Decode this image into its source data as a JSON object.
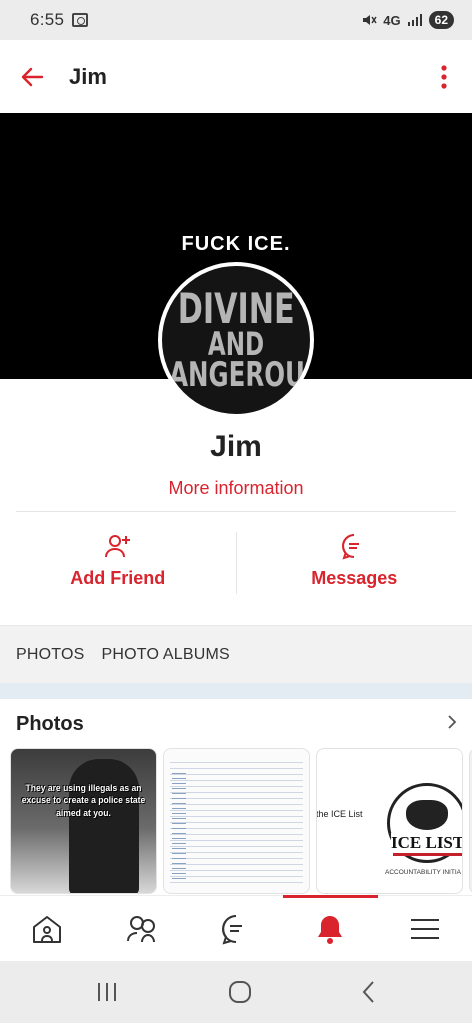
{
  "status_bar": {
    "time": "6:55",
    "network": "4G",
    "battery": "62"
  },
  "header": {
    "title": "Jim"
  },
  "cover": {
    "text": "FUCK ICE."
  },
  "avatar": {
    "line1": "DIVINE",
    "line2": "AND",
    "line3": "DANGEROUS"
  },
  "profile": {
    "name": "Jim",
    "more_info": "More information"
  },
  "actions": {
    "add_friend": "Add Friend",
    "messages": "Messages"
  },
  "tabs": [
    "PHOTOS",
    "PHOTO ALBUMS"
  ],
  "photos": {
    "title": "Photos",
    "thumb1_caption": "They are using illegals as an excuse to create a police state aimed at you.",
    "thumb3_text": "the ICE List",
    "thumb3_label": "ICE LIST",
    "thumb3_footer": "ACCOUNTABILITY INITIA"
  },
  "colors": {
    "accent": "#d9232d",
    "cover_bg": "#000000",
    "tabs_bg": "#f2f2f2"
  }
}
